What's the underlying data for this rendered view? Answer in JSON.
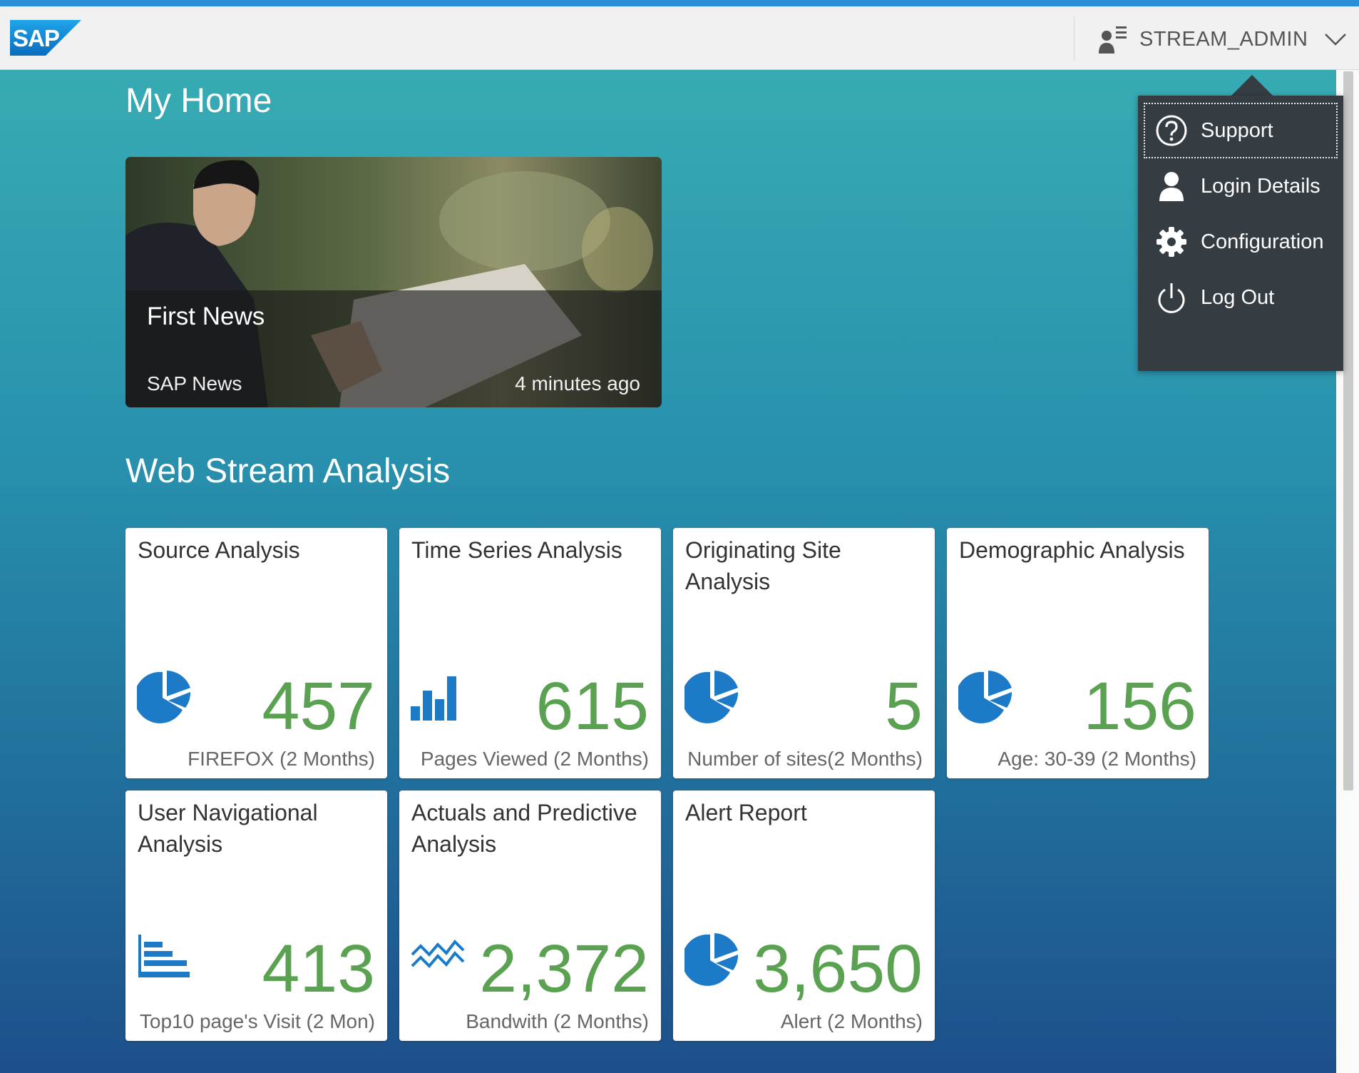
{
  "shell": {
    "logo_text": "SAP",
    "user_name": "STREAM_ADMIN"
  },
  "home": {
    "title": "My Home",
    "news": {
      "title": "First News",
      "source": "SAP News",
      "time": "4 minutes ago"
    }
  },
  "group": {
    "title": "Web Stream Analysis",
    "tiles": [
      {
        "title": "Source Analysis",
        "value": "457",
        "footer": "FIREFOX (2 Months)",
        "icon": "pie-chart-icon"
      },
      {
        "title": "Time Series Analysis",
        "value": "615",
        "footer": "Pages Viewed (2 Months)",
        "icon": "bar-chart-icon"
      },
      {
        "title": "Originating Site Analysis",
        "value": "5",
        "footer": "Number of sites(2 Months)",
        "icon": "pie-chart-icon"
      },
      {
        "title": "Demographic Analysis",
        "value": "156",
        "footer": "Age: 30-39 (2 Months)",
        "icon": "pie-chart-icon"
      },
      {
        "title": "User Navigational Analysis",
        "value": "413",
        "footer": "Top10 page's Visit (2 Mon)",
        "icon": "horizontal-bar-chart-icon"
      },
      {
        "title": "Actuals and Predictive Analysis",
        "value": "2,372",
        "footer": "Bandwith (2 Months)",
        "icon": "line-chart-icon"
      },
      {
        "title": "Alert Report",
        "value": "3,650",
        "footer": "Alert (2 Months)",
        "icon": "pie-chart-icon"
      }
    ]
  },
  "user_menu": {
    "items": [
      {
        "label": "Support",
        "icon": "help-icon"
      },
      {
        "label": "Login Details",
        "icon": "person-icon"
      },
      {
        "label": "Configuration",
        "icon": "gear-icon"
      },
      {
        "label": "Log Out",
        "icon": "power-icon"
      }
    ]
  },
  "colors": {
    "kpi_value": "#5aa252",
    "icon_blue": "#1c7ac7",
    "menu_bg": "#353c42",
    "top_accent": "#2b8fd6"
  }
}
